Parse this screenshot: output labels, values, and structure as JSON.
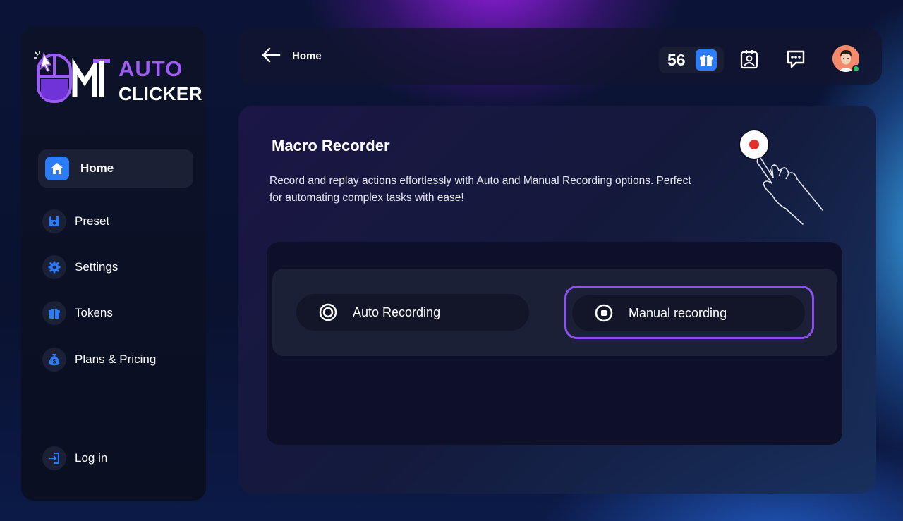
{
  "brand": {
    "logo_top": "AUTO",
    "logo_bottom": "CLICKER",
    "logo_mark": "MT"
  },
  "sidebar": {
    "items": [
      {
        "label": "Home",
        "icon": "home-icon",
        "active": true
      },
      {
        "label": "Preset",
        "icon": "preset-icon",
        "active": false
      },
      {
        "label": "Settings",
        "icon": "gear-icon",
        "active": false
      },
      {
        "label": "Tokens",
        "icon": "gift-icon",
        "active": false
      },
      {
        "label": "Plans & Pricing",
        "icon": "money-bag-icon",
        "active": false
      }
    ],
    "login": {
      "label": "Log in",
      "icon": "login-icon"
    }
  },
  "header": {
    "breadcrumb": "Home",
    "token_count": "56",
    "icons": [
      "gift-icon",
      "contact-icon",
      "chat-icon",
      "avatar"
    ],
    "online": true
  },
  "panel": {
    "title": "Macro Recorder",
    "description": "Record and replay actions effortlessly with Auto and Manual Recording options. Perfect for automating complex tasks with ease!",
    "options": [
      {
        "label": "Auto Recording",
        "icon": "ring-icon",
        "selected": false
      },
      {
        "label": "Manual recording",
        "icon": "stop-icon",
        "selected": true
      }
    ]
  },
  "colors": {
    "accent_blue": "#2b7cf6",
    "accent_purple": "#8c52ef",
    "record_red": "#e0322a",
    "online_green": "#26c25a"
  }
}
